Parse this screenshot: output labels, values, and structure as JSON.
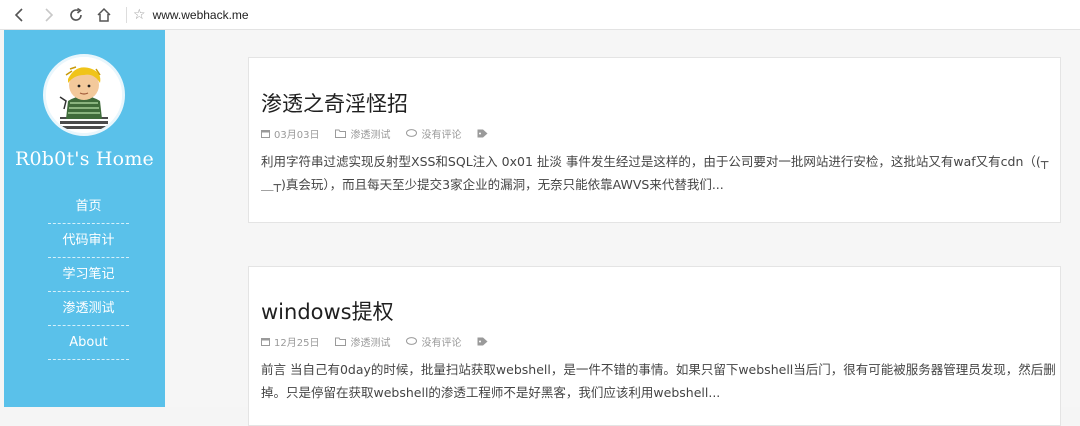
{
  "browser": {
    "url": "www.webhack.me",
    "back_icon": "back-arrow-icon",
    "forward_icon": "forward-arrow-icon",
    "reload_icon": "reload-icon",
    "home_icon": "home-icon",
    "bookmark_icon": "star-icon"
  },
  "sidebar": {
    "title": "R0b0t's Home",
    "background": "#5ac1ea",
    "items": [
      {
        "label": "首页"
      },
      {
        "label": "代码审计"
      },
      {
        "label": "学习笔记"
      },
      {
        "label": "渗透测试"
      },
      {
        "label": "About"
      }
    ]
  },
  "posts": [
    {
      "title": "渗透之奇淫怪招",
      "date": "03月03日",
      "category": "渗透测试",
      "comments": "没有评论",
      "excerpt": "利用字符串过滤实现反射型XSS和SQL注入 0x01 扯淡 事件发生经过是这样的，由于公司要对一批网站进行安检，这批站又有waf又有cdn（(┬＿┬)真会玩），而且每天至少提交3家企业的漏洞，无奈只能依靠AWVS来代替我们..."
    },
    {
      "title": "windows提权",
      "date": "12月25日",
      "category": "渗透测试",
      "comments": "没有评论",
      "excerpt": "前言 当自己有0day的时候，批量扫站获取webshell，是一件不错的事情。如果只留下webshell当后门，很有可能被服务器管理员发现，然后删掉。只是停留在获取webshell的渗透工程师不是好黑客，我们应该利用webshell..."
    }
  ]
}
